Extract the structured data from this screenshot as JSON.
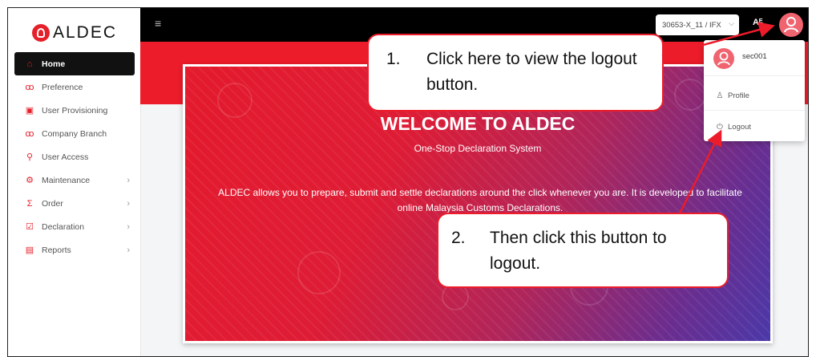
{
  "brand": {
    "logo_text": "ALDEC"
  },
  "sidebar": {
    "items": [
      {
        "label": "Home",
        "icon": "home-icon",
        "active": true,
        "submenu": false
      },
      {
        "label": "Preference",
        "icon": "link-icon",
        "active": false,
        "submenu": false
      },
      {
        "label": "User Provisioning",
        "icon": "user-box-icon",
        "active": false,
        "submenu": false
      },
      {
        "label": "Company Branch",
        "icon": "link-icon",
        "active": false,
        "submenu": false
      },
      {
        "label": "User Access",
        "icon": "user-key-icon",
        "active": false,
        "submenu": false
      },
      {
        "label": "Maintenance",
        "icon": "gear-icon",
        "active": false,
        "submenu": true
      },
      {
        "label": "Order",
        "icon": "sigma-icon",
        "active": false,
        "submenu": true
      },
      {
        "label": "Declaration",
        "icon": "check-box-icon",
        "active": false,
        "submenu": true
      },
      {
        "label": "Reports",
        "icon": "report-icon",
        "active": false,
        "submenu": true
      }
    ]
  },
  "topbar": {
    "org_select_value": "30653-X_11 / IFX",
    "lang_icon": "translate-icon",
    "avatar_icon": "user-avatar-icon"
  },
  "hero": {
    "title": "WELCOME TO ALDEC",
    "subtitle": "One-Stop Declaration System",
    "description": "ALDEC allows you to prepare, submit and settle declarations around the click whenever you are. It is developed to facilitate online Malaysia Customs Declarations."
  },
  "user_menu": {
    "username": "sec001",
    "items": [
      {
        "label": "Profile",
        "icon": "person-icon"
      },
      {
        "label": "Logout",
        "icon": "power-icon"
      }
    ]
  },
  "callouts": [
    {
      "number": "1.",
      "text": "Click here to view the logout button."
    },
    {
      "number": "2.",
      "text": "Then click this button to logout."
    }
  ],
  "colors": {
    "brand_red": "#ec1c2a",
    "topbar_bg": "#000000",
    "avatar_pink": "#f06470",
    "hero_purple": "#4b38a8"
  }
}
